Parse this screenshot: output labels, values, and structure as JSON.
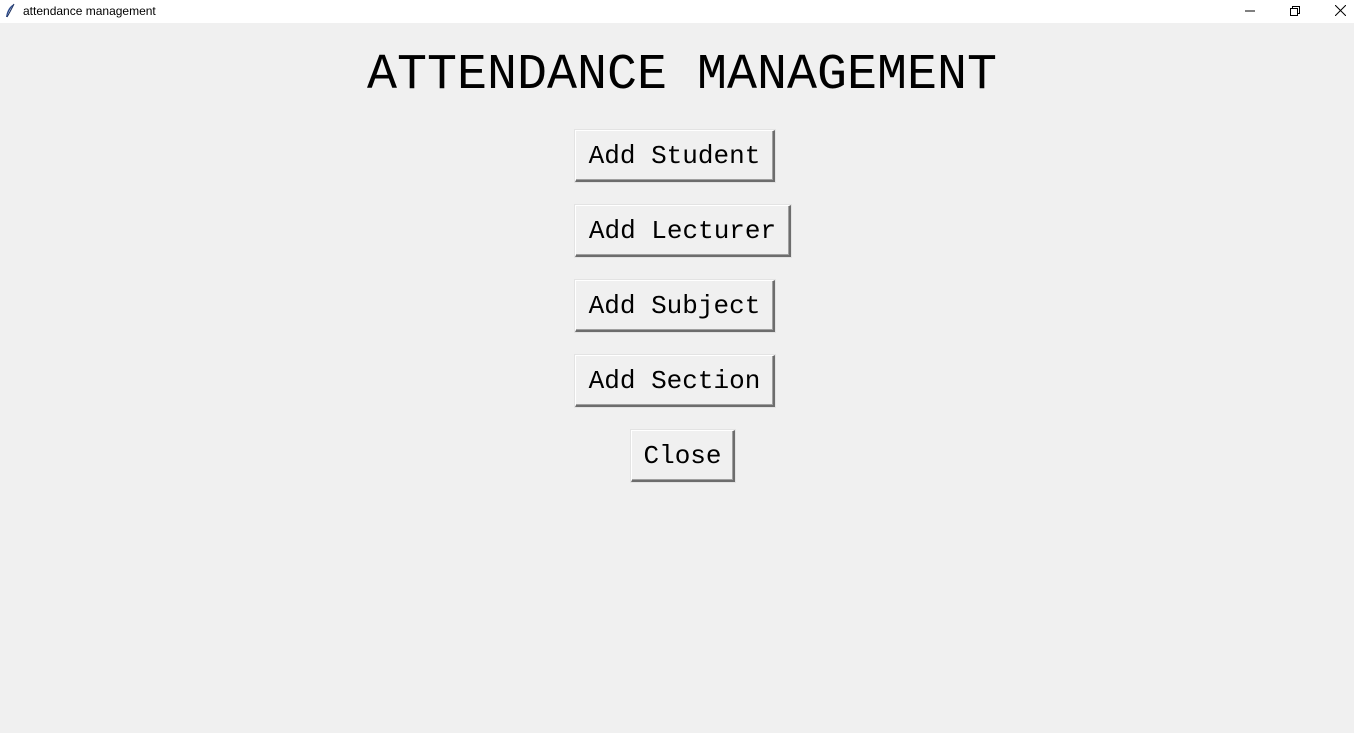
{
  "window": {
    "title": "attendance management",
    "icons": {
      "app": "feather-icon",
      "minimize": "minimize-icon",
      "restore": "restore-icon",
      "close": "close-icon"
    }
  },
  "main": {
    "heading": "ATTENDANCE MANAGEMENT",
    "buttons": {
      "add_student": "Add Student",
      "add_lecturer": "Add Lecturer",
      "add_subject": "Add Subject",
      "add_section": "Add Section",
      "close": "Close"
    }
  },
  "colors": {
    "background": "#f0f0f0",
    "titlebar": "#ffffff",
    "text": "#000000"
  }
}
